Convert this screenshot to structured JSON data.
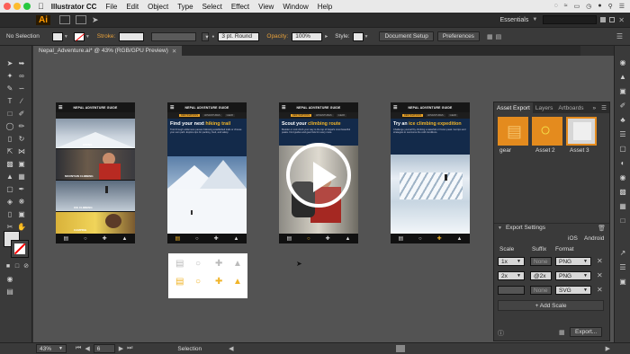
{
  "menubar": {
    "app_name": "Illustrator CC",
    "items": [
      "File",
      "Edit",
      "Object",
      "Type",
      "Select",
      "Effect",
      "View",
      "Window",
      "Help"
    ],
    "icon_names": [
      "apple-icon",
      "cc-icon",
      "wifi-icon",
      "battery-icon",
      "clock-icon",
      "user-icon",
      "search-icon",
      "list-icon"
    ]
  },
  "appbar": {
    "logo": "Ai",
    "workspace": "Essentials",
    "search_placeholder": ""
  },
  "control": {
    "selection": "No Selection",
    "stroke_label": "Stroke:",
    "stroke_value": "",
    "brush": "3 pt. Round",
    "opacity_label": "Opacity:",
    "opacity_value": "100%",
    "style_label": "Style:",
    "doc_setup": "Document Setup",
    "preferences": "Preferences"
  },
  "document": {
    "tab_title": "Nepal_Adventure.ai* @ 43% (RGB/GPU Preview)"
  },
  "artboards": [
    {
      "title": "NEPAL ADVENTURE GUIDE",
      "headline": "",
      "body": "",
      "labels": [
        "HIKING",
        "MOUNTAIN CLIMBING",
        "ICE CLIMBING",
        "CAMPING"
      ]
    },
    {
      "title": "NEPAL ADVENTURE GUIDE",
      "nav": [
        "DESTINATIONS",
        "ADVENTURES",
        "GEAR"
      ],
      "headline_a": "Find your next ",
      "headline_b": "hiking trail",
      "body": "Trek through wilderness passes following established trails or choose your own path. Explore tips for packing, food, and safety."
    },
    {
      "title": "NEPAL ADVENTURE GUIDE",
      "nav": [
        "DESTINATIONS",
        "ADVENTURES",
        "GEAR"
      ],
      "headline_a": "Scout your ",
      "headline_b": "climbing route",
      "body": "Boulder or rock climb your way to the top of Nepal's most beautiful peaks. Find guides and gear lists for every route."
    },
    {
      "title": "NEPAL ADVENTURE GUIDE",
      "nav": [
        "DESTINATIONS",
        "ADVENTURES",
        "GEAR"
      ],
      "headline_a": "Try an ",
      "headline_b": "ice climbing expedition",
      "body": "Challenge yourself by climbing a waterfall or frozen peak. Get tips and strategies to overcome the cold conditions."
    }
  ],
  "panel": {
    "tabs": [
      "Asset Export",
      "Layers",
      "Artboards"
    ],
    "assets": [
      "gear",
      "Asset 2",
      "Asset 3"
    ],
    "export_settings": "Export Settings",
    "platforms": [
      "iOS",
      "Android"
    ],
    "col_scale": "Scale",
    "col_suffix": "Suffix",
    "col_format": "Format",
    "rows": [
      {
        "scale": "1x",
        "suffix": "None",
        "format": "PNG"
      },
      {
        "scale": "2x",
        "suffix": "@2x",
        "format": "PNG"
      },
      {
        "scale": "",
        "suffix": "None",
        "format": "SVG"
      }
    ],
    "add_scale": "+ Add Scale",
    "export_btn": "Export..."
  },
  "status": {
    "zoom": "43%",
    "page": "6",
    "mode": "Selection"
  },
  "colors": {
    "accent": "#e48b1e",
    "yellow": "#f0b429",
    "canvas": "#535353",
    "ui": "#3a3a3a"
  }
}
